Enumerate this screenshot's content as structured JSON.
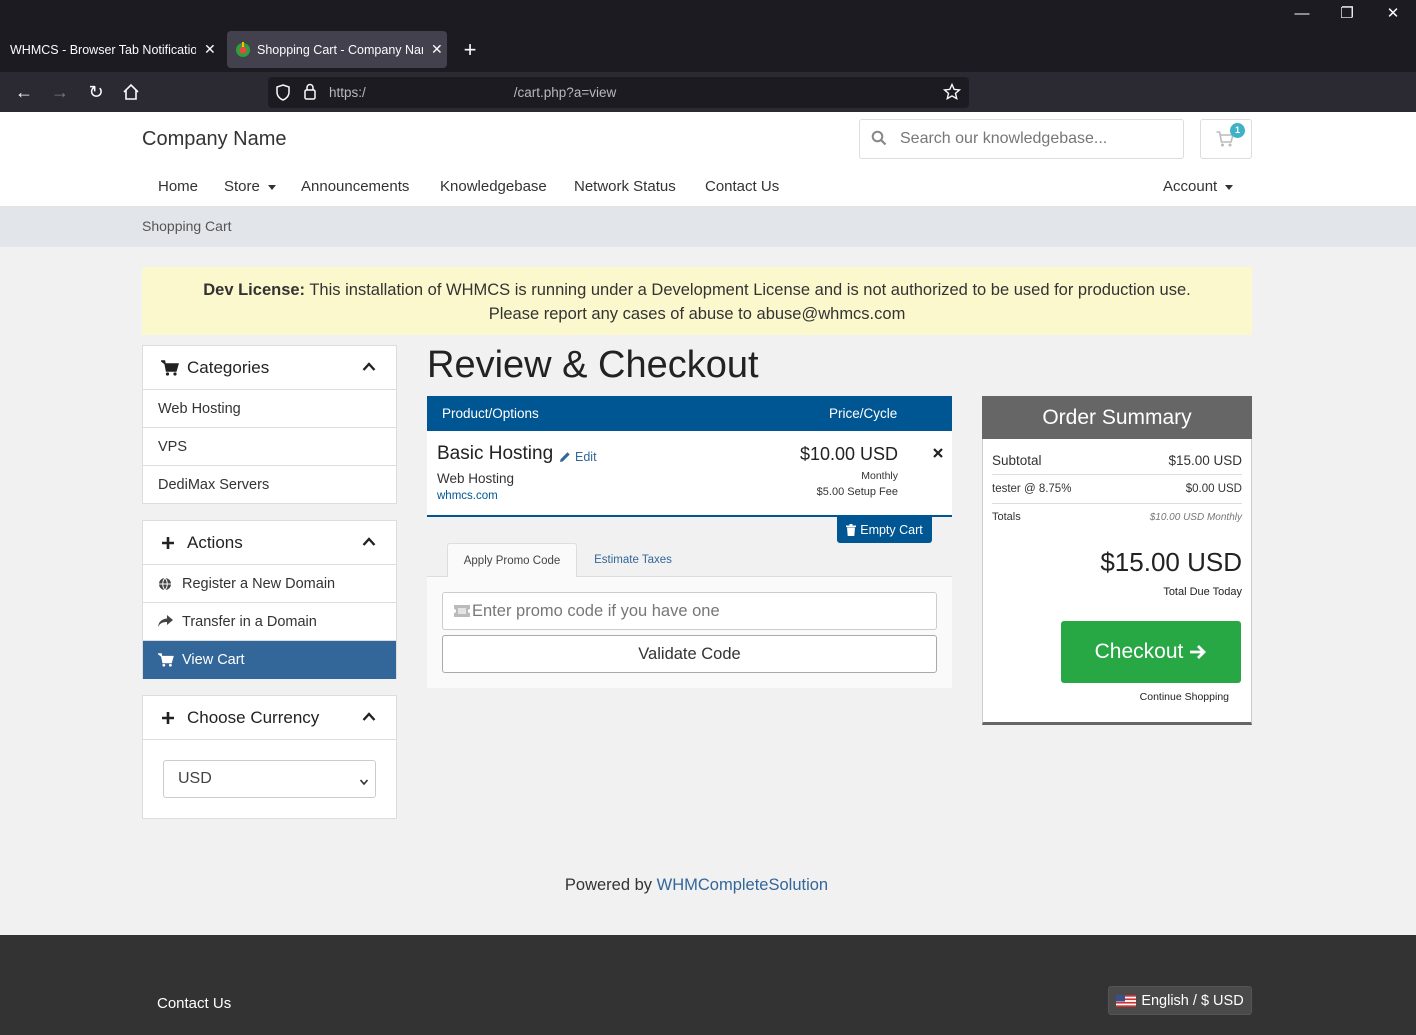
{
  "browser": {
    "tabs": [
      {
        "title": "WHMCS - Browser Tab Notification",
        "active": false
      },
      {
        "title": "Shopping Cart - Company Name",
        "active": true
      }
    ],
    "url_start": "https:/",
    "url_end": "/cart.php?a=view"
  },
  "header": {
    "brand": "Company Name",
    "search_placeholder": "Search our knowledgebase...",
    "cart_count": "1"
  },
  "nav": {
    "items": [
      "Home",
      "Store",
      "Announcements",
      "Knowledgebase",
      "Network Status",
      "Contact Us"
    ],
    "account": "Account"
  },
  "breadcrumb": "Shopping Cart",
  "dev_license": {
    "label": "Dev License:",
    "text": "This installation of WHMCS is running under a Development License and is not authorized to be used for production use.",
    "text2": "Please report any cases of abuse to abuse@whmcs.com"
  },
  "sidebar": {
    "categories": {
      "title": "Categories",
      "items": [
        "Web Hosting",
        "VPS",
        "DediMax Servers"
      ]
    },
    "actions": {
      "title": "Actions",
      "items": [
        "Register a New Domain",
        "Transfer in a Domain",
        "View Cart"
      ]
    },
    "currency": {
      "title": "Choose Currency",
      "selected": "USD"
    }
  },
  "main": {
    "title": "Review & Checkout",
    "col_product": "Product/Options",
    "col_price": "Price/Cycle",
    "item": {
      "name": "Basic Hosting",
      "edit": "Edit",
      "group": "Web Hosting",
      "domain": "whmcs.com",
      "price": "$10.00 USD",
      "cycle": "Monthly",
      "setup": "$5.00 Setup Fee"
    },
    "empty_cart": "Empty Cart",
    "tab_promo": "Apply Promo Code",
    "tab_taxes": "Estimate Taxes",
    "promo_placeholder": "Enter promo code if you have one",
    "validate": "Validate Code"
  },
  "summary": {
    "title": "Order Summary",
    "subtotal_label": "Subtotal",
    "subtotal": "$15.00 USD",
    "tax_label": "tester @ 8.75%",
    "tax": "$0.00 USD",
    "totals_label": "Totals",
    "totals": "$10.00 USD Monthly",
    "due": "$15.00 USD",
    "due_label": "Total Due Today",
    "checkout": "Checkout",
    "continue": "Continue Shopping"
  },
  "footer": {
    "powered_prefix": "Powered by",
    "powered_link": "WHMCompleteSolution",
    "contact": "Contact Us",
    "language": "English / $ USD"
  },
  "colors": {
    "primary": "#005693",
    "active_nav": "#336699",
    "success": "#28a745",
    "dev_license_bg": "#fcf8cd"
  }
}
